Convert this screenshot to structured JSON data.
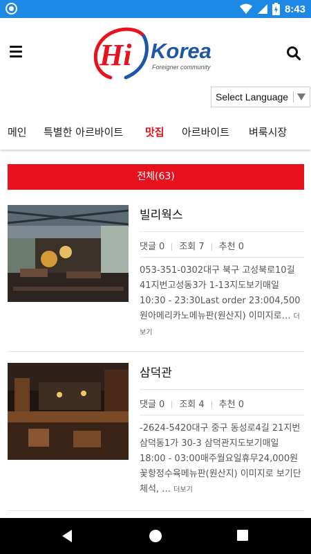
{
  "status_bar": {
    "time": "8:43"
  },
  "header": {
    "logo_hi": "Hi",
    "logo_korea": "Korea",
    "logo_sub": "Foreigner community"
  },
  "language": {
    "label": "Select Language"
  },
  "nav": {
    "items": [
      {
        "label": "메인"
      },
      {
        "label": "특별한 아르바이트"
      },
      {
        "label": "맛집"
      },
      {
        "label": "아르바이트"
      },
      {
        "label": "벼룩시장"
      }
    ],
    "active": "맛집"
  },
  "filter": {
    "label": "전체(63)"
  },
  "posts": [
    {
      "title": "빌리웍스",
      "comments": "댓글 0",
      "views": "조회 7",
      "recommend": "추천 0",
      "body": "053-351-0302대구 북구 고성북로10길 41지번고성동3가 1-13지도보기매일 10:30 - 23:30Last order 23:004,500원아메리카노메뉴판(원산지) 이미지로…",
      "more": "더보기"
    },
    {
      "title": "삼덕관",
      "comments": "댓글 0",
      "views": "조회 4",
      "recommend": "추천 0",
      "body": "-2624-5420대구 중구 동성로4길 21지번삼덕동1가 30-3 삼덕관지도보기매일 18:00 - 03:00매주월요일휴무24,000원꽃항정수육메뉴판(원산지) 이미지로 보기단체석, …",
      "more": "더보기"
    }
  ],
  "colors": {
    "status_bar": "#1e88e5",
    "accent_red": "#e8121e",
    "logo_blue": "#1e56a8"
  }
}
